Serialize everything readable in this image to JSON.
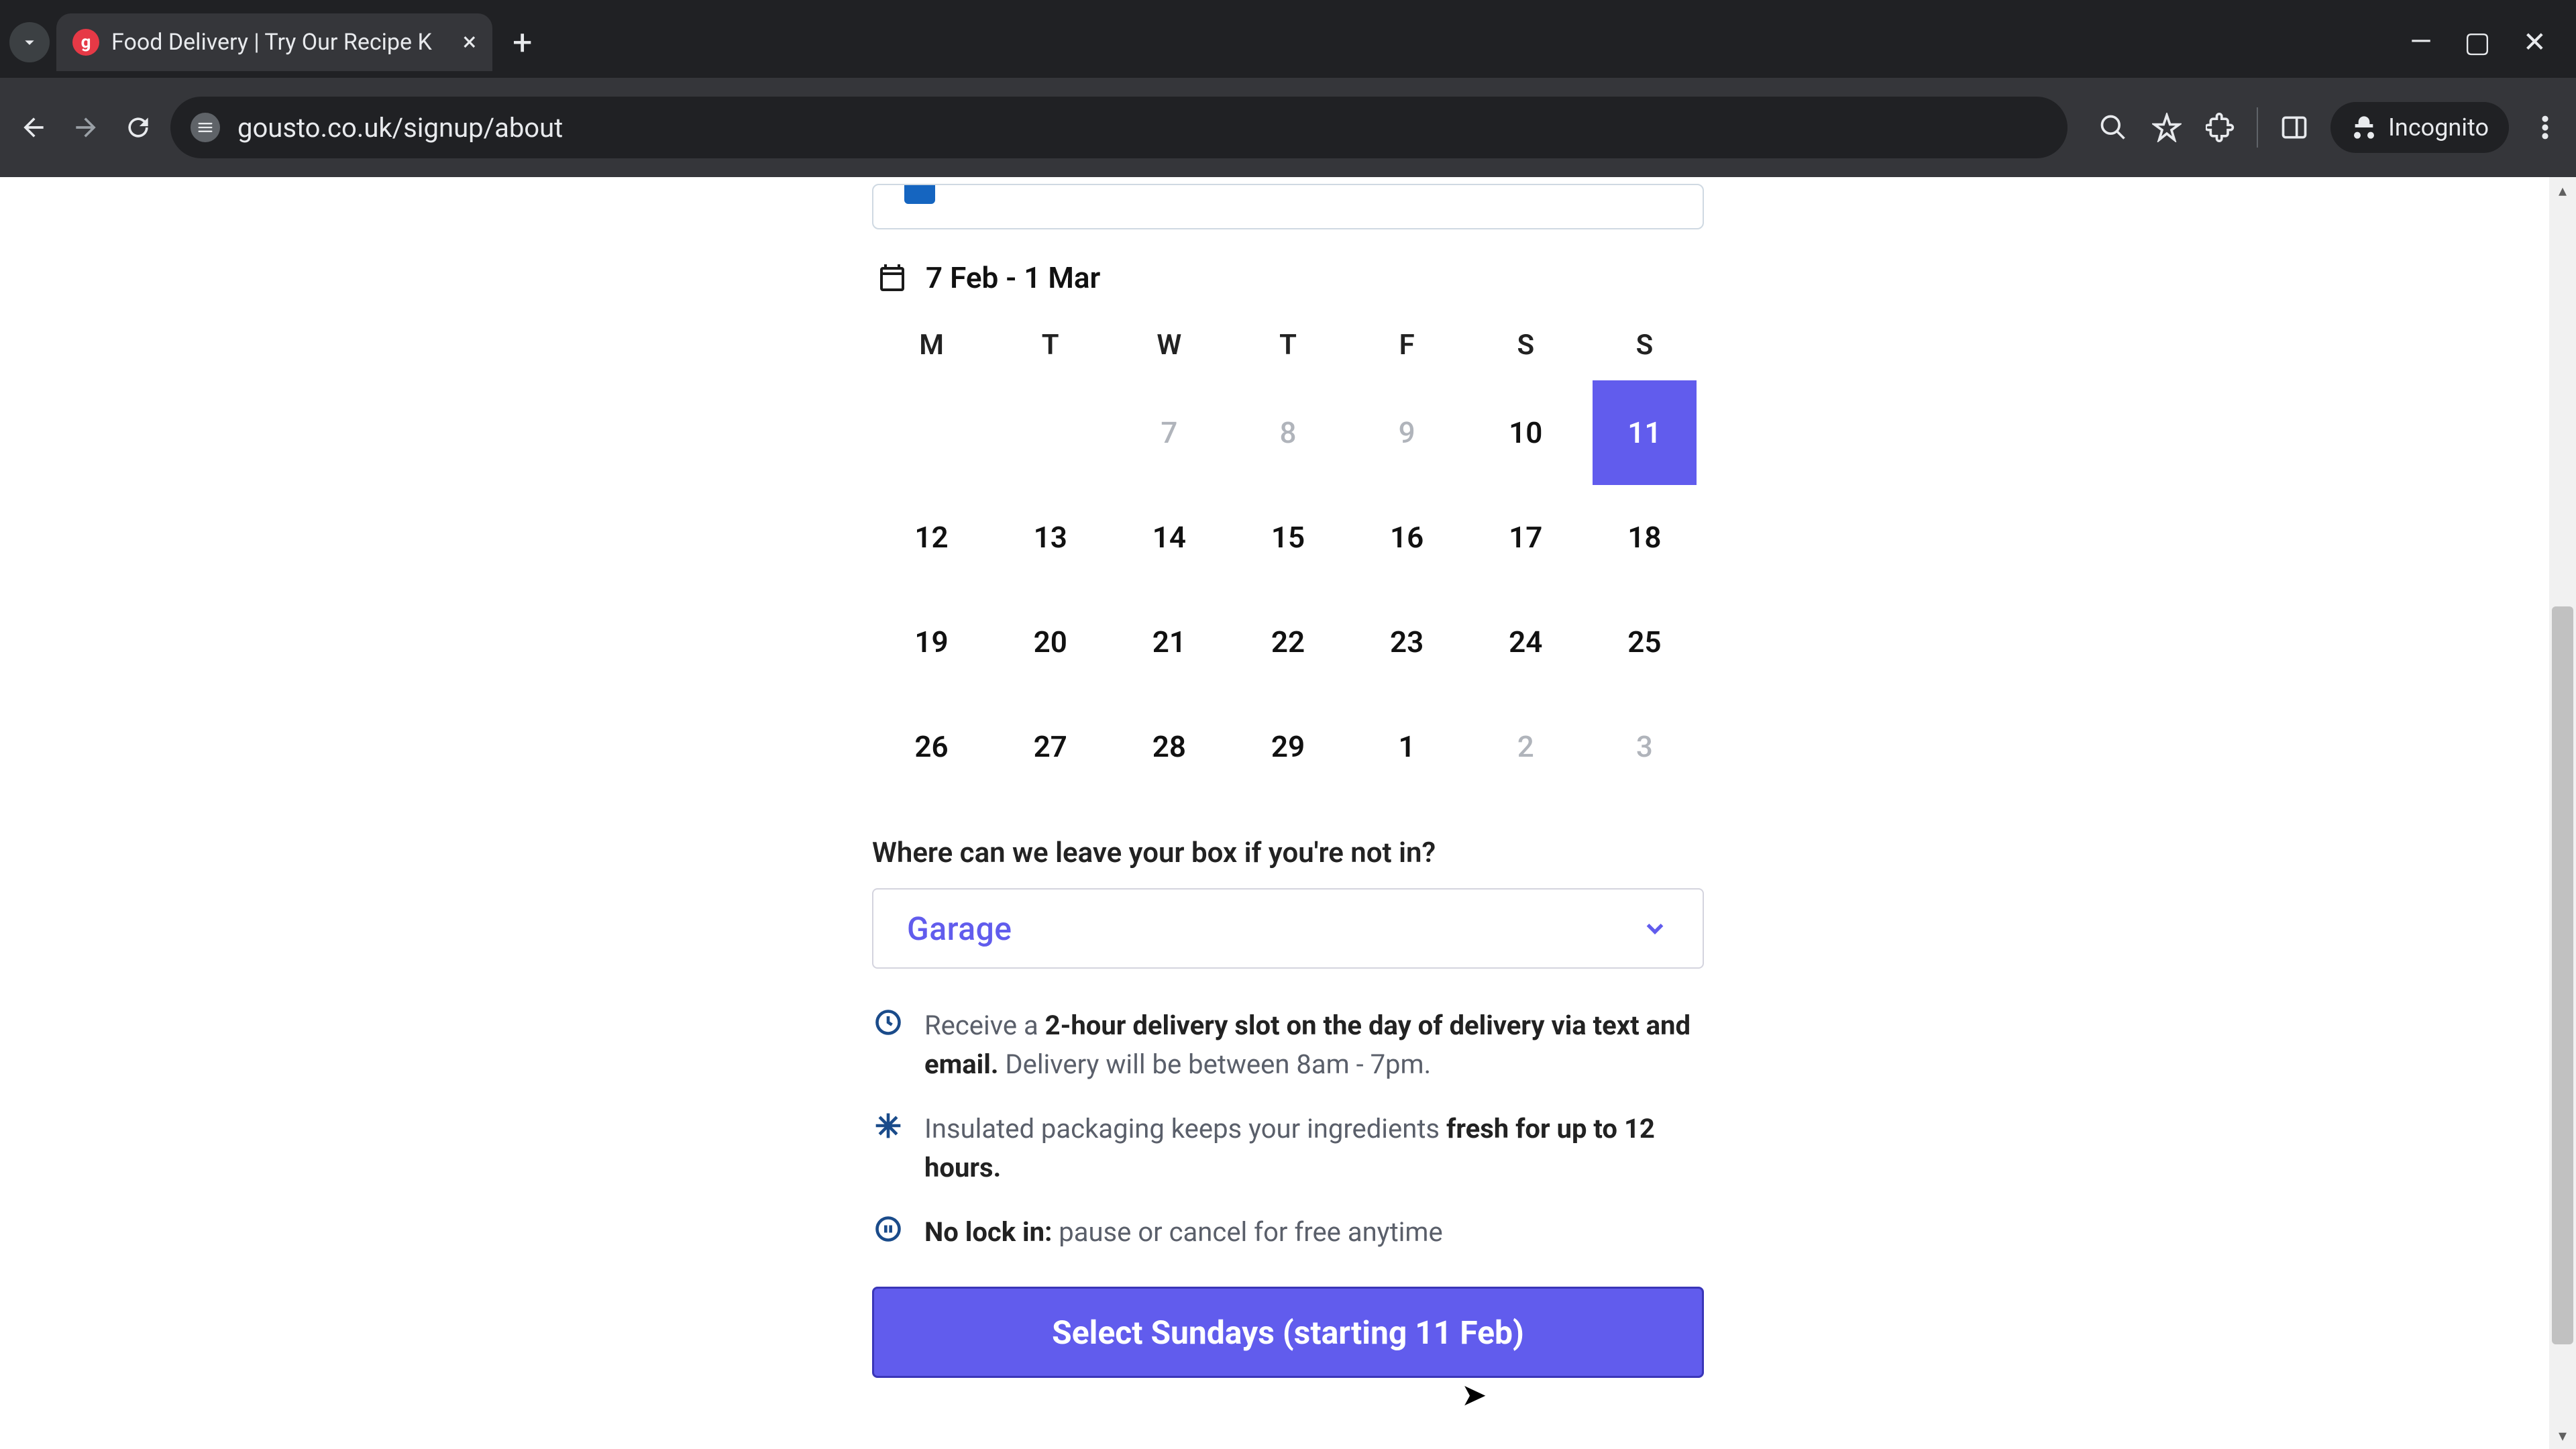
{
  "browser": {
    "tab_title": "Food Delivery | Try Our Recipe K",
    "url": "gousto.co.uk/signup/about",
    "incognito_label": "Incognito"
  },
  "calendar": {
    "range_label": "7 Feb - 1 Mar",
    "weekdays": [
      "M",
      "T",
      "W",
      "T",
      "F",
      "S",
      "S"
    ],
    "rows": [
      [
        {
          "n": "",
          "state": "empty"
        },
        {
          "n": "",
          "state": "empty"
        },
        {
          "n": "7",
          "state": "disabled"
        },
        {
          "n": "8",
          "state": "disabled"
        },
        {
          "n": "9",
          "state": "disabled"
        },
        {
          "n": "10",
          "state": "normal"
        },
        {
          "n": "11",
          "state": "selected"
        }
      ],
      [
        {
          "n": "12",
          "state": "normal"
        },
        {
          "n": "13",
          "state": "normal"
        },
        {
          "n": "14",
          "state": "normal"
        },
        {
          "n": "15",
          "state": "normal"
        },
        {
          "n": "16",
          "state": "normal"
        },
        {
          "n": "17",
          "state": "normal"
        },
        {
          "n": "18",
          "state": "normal"
        }
      ],
      [
        {
          "n": "19",
          "state": "normal"
        },
        {
          "n": "20",
          "state": "normal"
        },
        {
          "n": "21",
          "state": "normal"
        },
        {
          "n": "22",
          "state": "normal"
        },
        {
          "n": "23",
          "state": "normal"
        },
        {
          "n": "24",
          "state": "normal"
        },
        {
          "n": "25",
          "state": "normal"
        }
      ],
      [
        {
          "n": "26",
          "state": "normal"
        },
        {
          "n": "27",
          "state": "normal"
        },
        {
          "n": "28",
          "state": "normal"
        },
        {
          "n": "29",
          "state": "normal"
        },
        {
          "n": "1",
          "state": "normal"
        },
        {
          "n": "2",
          "state": "disabled"
        },
        {
          "n": "3",
          "state": "disabled"
        }
      ]
    ]
  },
  "safe_place": {
    "question": "Where can we leave your box if you're not in?",
    "selected": "Garage"
  },
  "info": {
    "slot_pre": "Receive a ",
    "slot_bold": "2-hour delivery slot on the day of delivery via text and email.",
    "slot_post": " Delivery will be between 8am - 7pm.",
    "pack_pre": "Insulated packaging keeps your ingredients ",
    "pack_bold": "fresh for up to 12 hours.",
    "lock_bold": "No lock in:",
    "lock_post": " pause or cancel for free anytime"
  },
  "cta_label": "Select Sundays (starting 11 Feb)"
}
